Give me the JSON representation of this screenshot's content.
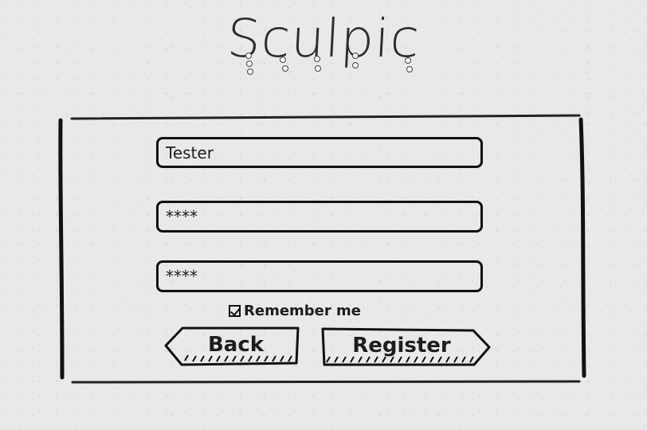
{
  "app": {
    "title": "Sculpic"
  },
  "form": {
    "username": {
      "value": "Tester"
    },
    "password": {
      "value": "****"
    },
    "confirm_password": {
      "value": "****"
    },
    "remember": {
      "label": "Remember me",
      "checked": true
    },
    "buttons": {
      "back": "Back",
      "register": "Register"
    }
  },
  "colors": {
    "paper": "#e9e9e7",
    "ink": "#111111"
  }
}
